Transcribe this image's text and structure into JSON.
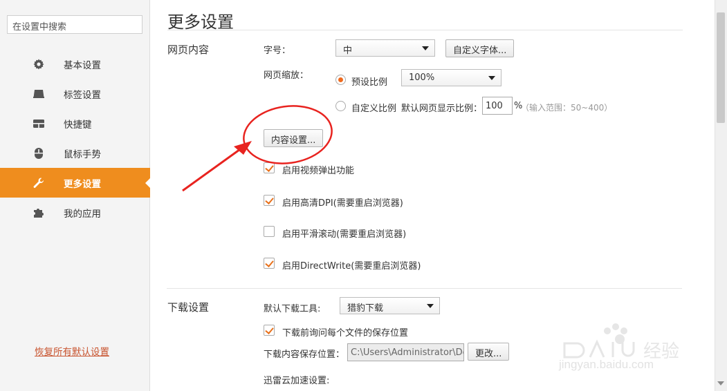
{
  "sidebar": {
    "search_placeholder": "在设置中搜索",
    "items": [
      {
        "label": "基本设置",
        "icon": "gear-icon"
      },
      {
        "label": "标签设置",
        "icon": "tab-icon"
      },
      {
        "label": "快捷键",
        "icon": "keyboard-icon"
      },
      {
        "label": "鼠标手势",
        "icon": "mouse-icon"
      },
      {
        "label": "更多设置",
        "icon": "wrench-icon",
        "active": true
      },
      {
        "label": "我的应用",
        "icon": "puzzle-icon"
      }
    ],
    "restore_label": "恢复所有默认设置"
  },
  "page": {
    "title": "更多设置"
  },
  "web_content": {
    "section_title": "网页内容",
    "font_size_label": "字号：",
    "font_size_value": "中",
    "custom_font_button": "自定义字体...",
    "zoom_label": "网页缩放：",
    "preset_ratio_label": "预设比例",
    "preset_ratio_value": "100%",
    "custom_ratio_label": "自定义比例",
    "default_ratio_label": "默认网页显示比例：",
    "default_ratio_value": "100",
    "percent_sign": "%",
    "range_hint": "（输入范围：50~400）",
    "content_settings_button": "内容设置...",
    "checkboxes": [
      {
        "label": "启用视频弹出功能",
        "checked": true
      },
      {
        "label": "启用高清DPI(需要重启浏览器)",
        "checked": true
      },
      {
        "label": "启用平滑滚动(需要重启浏览器)",
        "checked": false
      },
      {
        "label": "启用DirectWrite(需要重启浏览器)",
        "checked": true
      }
    ]
  },
  "download": {
    "section_title": "下载设置",
    "default_tool_label": "默认下载工具:",
    "default_tool_value": "猎豹下载",
    "ask_location_label": "下载前询问每个文件的保存位置",
    "ask_location_checked": true,
    "save_location_label": "下载内容保存位置：",
    "save_location_value": "C:\\Users\\Administrator\\Desk",
    "change_button": "更改...",
    "xunlei_label": "迅雷云加速设置:"
  },
  "watermark": {
    "text": "jingyan.baidu.com"
  },
  "colors": {
    "accent": "#ef8d1e",
    "annotation": "#e8231f",
    "link": "#c8532e"
  }
}
